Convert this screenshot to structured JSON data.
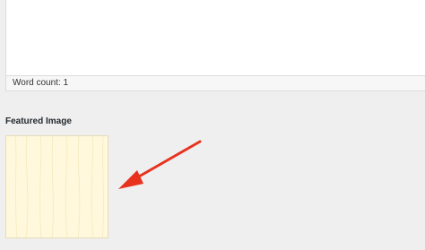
{
  "editor": {
    "word_count_label": "Word count: 1"
  },
  "featured_image": {
    "section_title": "Featured Image",
    "image_color": "#fff8dc"
  },
  "annotation": {
    "arrow_color": "#e8321e",
    "icon": "red-arrow-icon"
  }
}
